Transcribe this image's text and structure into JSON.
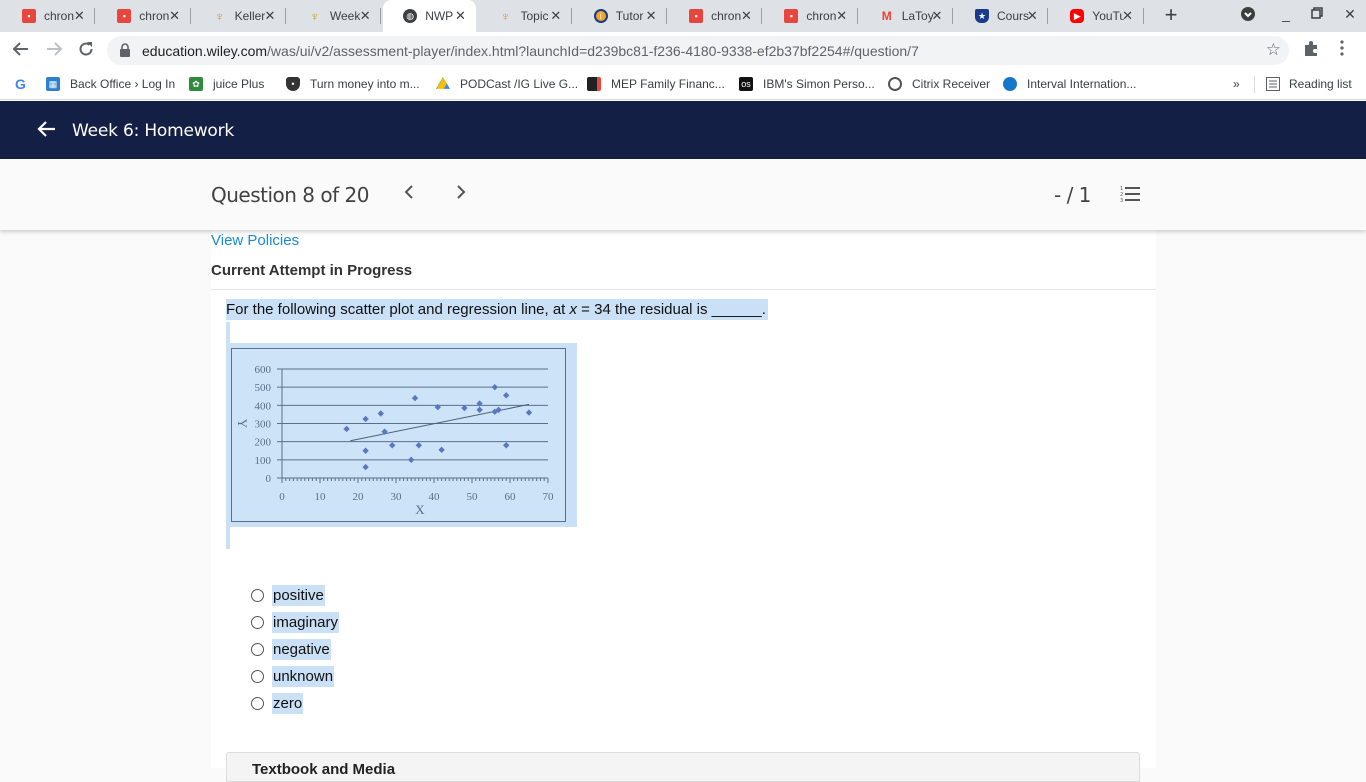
{
  "browser": {
    "tabs": [
      {
        "title": "chron",
        "icon": "red-square-icon",
        "active": false
      },
      {
        "title": "chron",
        "icon": "red-square-icon",
        "active": false
      },
      {
        "title": "Keller",
        "icon": "keller-shield-icon",
        "active": false
      },
      {
        "title": "Week",
        "icon": "keller-shield-icon",
        "active": false
      },
      {
        "title": "NWP",
        "icon": "globe-icon",
        "active": true
      },
      {
        "title": "Topic",
        "icon": "keller-shield-icon",
        "active": false
      },
      {
        "title": "Tutor",
        "icon": "tutor-icon",
        "active": false
      },
      {
        "title": "chron",
        "icon": "red-square-icon",
        "active": false
      },
      {
        "title": "chron",
        "icon": "red-square-icon",
        "active": false
      },
      {
        "title": "LaToy",
        "icon": "gmail-icon",
        "active": false
      },
      {
        "title": "Cours",
        "icon": "course-shield-icon",
        "active": false
      },
      {
        "title": "YouTu",
        "icon": "youtube-icon",
        "active": false
      }
    ],
    "url_host": "education.wiley.com",
    "url_path": "/was/ui/v2/assessment-player/index.html?launchId=d239bc81-f236-4180-9338-ef2b37bf2254#/question/7",
    "bookmarks": [
      {
        "label": "Back Office › Log In",
        "icon": "backoffice-icon"
      },
      {
        "label": "juice Plus",
        "icon": "juiceplus-icon"
      },
      {
        "label": "Turn money into m...",
        "icon": "shield-icon"
      },
      {
        "label": "PODCast /IG Live G...",
        "icon": "google-drive-icon"
      },
      {
        "label": "MEP Family Financ...",
        "icon": "mep-icon"
      },
      {
        "label": "IBM's Simon Perso...",
        "icon": "os-icon"
      },
      {
        "label": "Citrix Receiver",
        "icon": "citrix-icon"
      },
      {
        "label": "Interval Internation...",
        "icon": "blue-dot-icon"
      }
    ],
    "more_bookmarks": "»",
    "reading_list": "Reading list"
  },
  "app": {
    "title": "Week 6: Homework",
    "question_label": "Question 8 of 20",
    "score": "- / 1",
    "view_policies": "View Policies",
    "attempt_status": "Current Attempt in Progress",
    "question_text_pre": "For the following scatter plot and regression line, at ",
    "question_var": "x",
    "question_text_post": " = 34 the residual is ______.",
    "options": [
      "positive",
      "imaginary",
      "negative",
      "unknown",
      "zero"
    ],
    "textbook_label": "Textbook and Media",
    "colors": {
      "header_bg": "#141f45",
      "link": "#1a8ad4",
      "selection": "#c9e0f7"
    }
  },
  "chart_data": {
    "type": "scatter",
    "title": "",
    "xlabel": "X",
    "ylabel": "Y",
    "xlim": [
      0,
      70
    ],
    "ylim": [
      0,
      600
    ],
    "xticks": [
      0,
      10,
      20,
      30,
      40,
      50,
      60,
      70
    ],
    "yticks": [
      0,
      100,
      200,
      300,
      400,
      500,
      600
    ],
    "grid": "horizontal",
    "points": [
      [
        17,
        270
      ],
      [
        22,
        325
      ],
      [
        22,
        150
      ],
      [
        22,
        60
      ],
      [
        26,
        355
      ],
      [
        27,
        255
      ],
      [
        29,
        180
      ],
      [
        34,
        100
      ],
      [
        35,
        440
      ],
      [
        36,
        180
      ],
      [
        41,
        390
      ],
      [
        42,
        155
      ],
      [
        48,
        385
      ],
      [
        52,
        410
      ],
      [
        52,
        375
      ],
      [
        56,
        500
      ],
      [
        56,
        365
      ],
      [
        57,
        375
      ],
      [
        59,
        455
      ],
      [
        59,
        180
      ],
      [
        65,
        360
      ]
    ],
    "regression_line": {
      "x": [
        18,
        65
      ],
      "y": [
        205,
        405
      ]
    },
    "colors": {
      "points": "#5a78c2",
      "grid": "#5c6f88",
      "background": "#cce3f8"
    }
  }
}
